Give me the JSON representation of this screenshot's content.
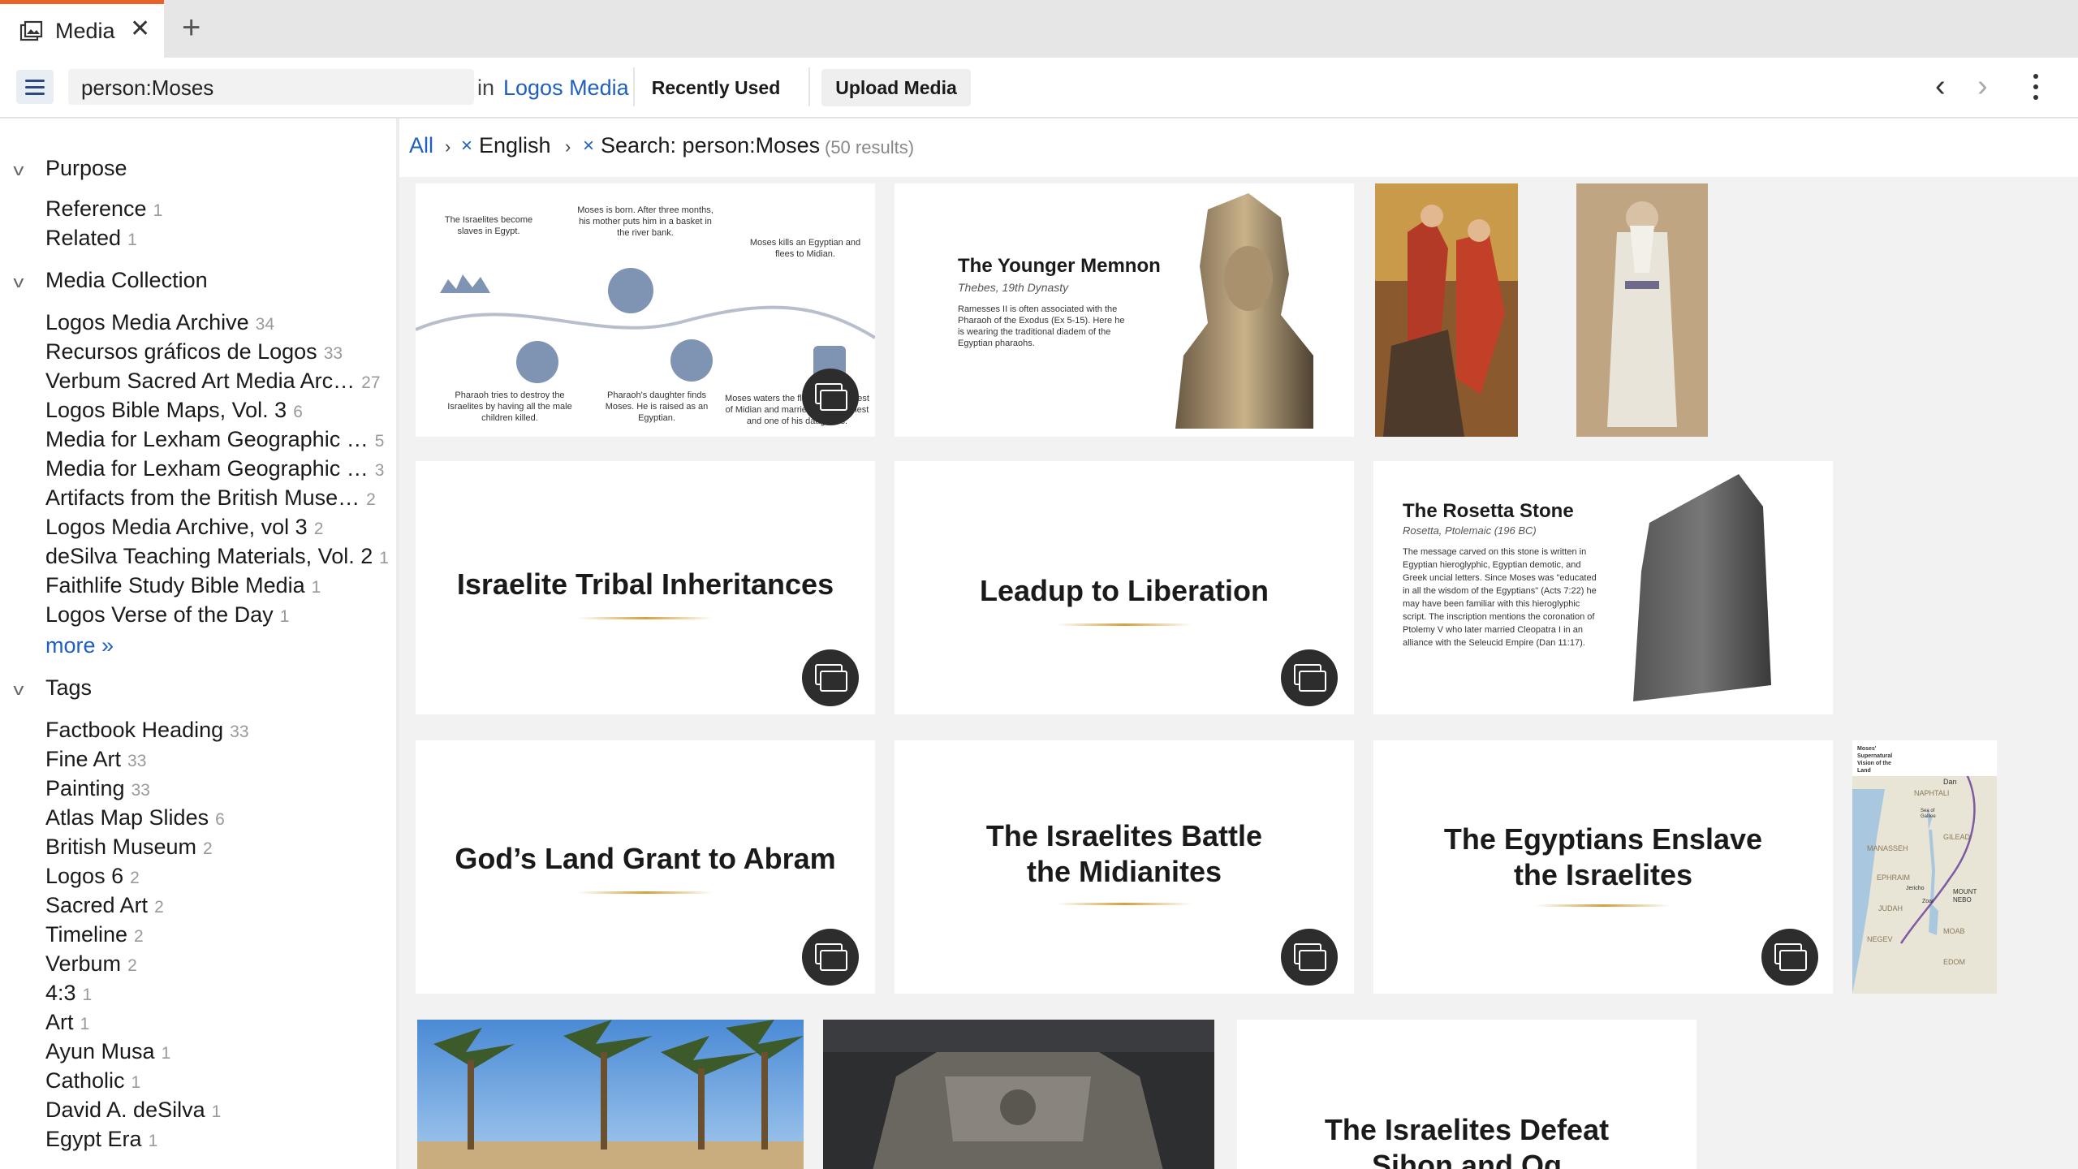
{
  "tab": {
    "title": "Media"
  },
  "toolbar": {
    "search_value": "person:Moses",
    "in_label": "in",
    "in_link": "Logos Media",
    "recently_used": "Recently Used",
    "upload_media": "Upload Media"
  },
  "sidebar": {
    "purpose": {
      "title": "Purpose",
      "items": [
        {
          "label": "Reference",
          "count": "1"
        },
        {
          "label": "Related",
          "count": "1"
        }
      ]
    },
    "collection": {
      "title": "Media Collection",
      "items": [
        {
          "label": "Logos Media Archive",
          "count": "34"
        },
        {
          "label": "Recursos gráficos de Logos",
          "count": "33"
        },
        {
          "label": "Verbum Sacred Art Media Arc…",
          "count": "27"
        },
        {
          "label": "Logos Bible Maps, Vol. 3",
          "count": "6"
        },
        {
          "label": "Media for Lexham Geographic …",
          "count": "5"
        },
        {
          "label": "Media for Lexham Geographic …",
          "count": "3"
        },
        {
          "label": "Artifacts from the British Muse…",
          "count": "2"
        },
        {
          "label": "Logos Media Archive, vol 3",
          "count": "2"
        },
        {
          "label": "deSilva Teaching Materials, Vol. 2",
          "count": "1"
        },
        {
          "label": "Faithlife Study Bible Media",
          "count": "1"
        },
        {
          "label": "Logos Verse of the Day",
          "count": "1"
        }
      ],
      "more": "more »"
    },
    "tags": {
      "title": "Tags",
      "items": [
        {
          "label": "Factbook Heading",
          "count": "33"
        },
        {
          "label": "Fine Art",
          "count": "33"
        },
        {
          "label": "Painting",
          "count": "33"
        },
        {
          "label": "Atlas Map Slides",
          "count": "6"
        },
        {
          "label": "British Museum",
          "count": "2"
        },
        {
          "label": "Logos 6",
          "count": "2"
        },
        {
          "label": "Sacred Art",
          "count": "2"
        },
        {
          "label": "Timeline",
          "count": "2"
        },
        {
          "label": "Verbum",
          "count": "2"
        },
        {
          "label": "4:3",
          "count": "1"
        },
        {
          "label": "Art",
          "count": "1"
        },
        {
          "label": "Ayun Musa",
          "count": "1"
        },
        {
          "label": "Catholic",
          "count": "1"
        },
        {
          "label": "David A. deSilva",
          "count": "1"
        },
        {
          "label": "Egypt Era",
          "count": "1"
        }
      ]
    }
  },
  "breadcrumb": {
    "all": "All",
    "english": "English",
    "search": "Search: person:Moses",
    "results": "(50 results)"
  },
  "cards": {
    "timeline": {
      "t1": "The Israelites become slaves in Egypt.",
      "t2": "Moses is born. After three months, his mother puts him in a basket in the river bank.",
      "t3": "Moses kills an Egyptian and flees to Midian.",
      "t4": "Pharaoh tries to destroy the Israelites by having all the male children killed.",
      "t5": "Pharaoh's daughter finds Moses. He is raised as an Egyptian.",
      "t6": "Moses waters the flocks of the priest of Midian and marries with the priest and one of his daughters."
    },
    "memnon": {
      "title": "The Younger Memnon",
      "subtitle": "Thebes, 19th Dynasty",
      "body": "Ramesses II is often associated with the Pharaoh of the Exodus (Ex 5-15). Here he is wearing the traditional diadem of the Egyptian pharaohs."
    },
    "tribal": "Israelite Tribal Inheritances",
    "leadup": "Leadup to Liberation",
    "rosetta": {
      "title": "The Rosetta Stone",
      "subtitle": "Rosetta, Ptolemaic (196 BC)",
      "body": "The message carved on this stone is written in Egyptian hieroglyphic, Egyptian demotic, and Greek uncial letters. Since Moses was \"educated in all the wisdom of the Egyptians\" (Acts 7:22) he may have been familiar with this hieroglyphic script. The inscription mentions the coronation of Ptolemy V who later married Cleopatra I in an alliance with the Seleucid Empire (Dan 11:17)."
    },
    "land_grant": "God’s Land Grant to Abram",
    "battle_l1": "The Israelites Battle",
    "battle_l2": "the Midianites",
    "enslave_l1": "The Egyptians Enslave",
    "enslave_l2": "the Israelites",
    "map": {
      "title": "Moses' Supernatural Vision of the Land",
      "labels": [
        "Dan",
        "NAPHTALI",
        "GILEAD",
        "MANASSEH",
        "EPHRAIM",
        "Jericho",
        "MOUNT NEBO",
        "JUDAH",
        "MOAB",
        "NEGEV",
        "EDOM",
        "Zoar",
        "Sea of Galilee"
      ]
    },
    "defeat_l1": "The Israelites Defeat",
    "defeat_l2": "Sihon and Og"
  },
  "colors": {
    "accent_tab": "#e8622a",
    "link": "#1f5fbf",
    "gold": "#d4a03c"
  }
}
